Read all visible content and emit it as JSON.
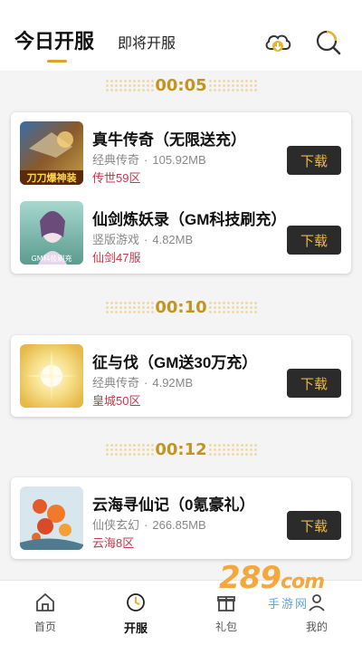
{
  "header": {
    "tab_today": "今日开服",
    "tab_upcoming": "即将开服"
  },
  "groups": [
    {
      "time": "00:05",
      "games": [
        {
          "title": "真牛传奇（无限送充）",
          "category": "经典传奇",
          "size": "105.92MB",
          "server": "传世59区",
          "button": "下载",
          "thumb_text": "刀刀爆神装"
        },
        {
          "title": "仙剑炼妖录（GM科技刷充）",
          "category": "竖版游戏",
          "size": "4.82MB",
          "server": "仙剑47服",
          "button": "下载",
          "thumb_text": "GM科技刷充"
        }
      ]
    },
    {
      "time": "00:10",
      "games": [
        {
          "title": "征与伐（GM送30万充）",
          "category": "经典传奇",
          "size": "4.92MB",
          "server": "皇城50区",
          "button": "下载"
        }
      ]
    },
    {
      "time": "00:12",
      "games": [
        {
          "title": "云海寻仙记（0氪豪礼）",
          "category": "仙侠玄幻",
          "size": "266.85MB",
          "server": "云海8区",
          "button": "下载"
        }
      ]
    }
  ],
  "nav": {
    "home": "首页",
    "open_server": "开服",
    "gift": "礼包",
    "mine": "我的"
  },
  "watermark": {
    "logo": "289",
    "suffix": "com",
    "sub": "手游网"
  },
  "colors": {
    "accent_gold": "#c49421",
    "server_red": "#c0394f",
    "button_bg": "#2b2b2b",
    "button_text": "#e7b84a"
  }
}
